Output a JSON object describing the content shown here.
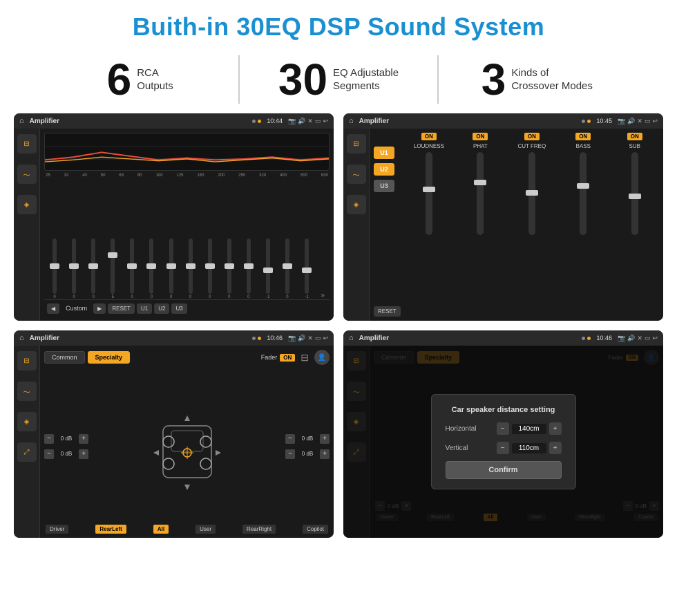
{
  "page": {
    "title": "Buith-in 30EQ DSP Sound System"
  },
  "stats": [
    {
      "number": "6",
      "label_line1": "RCA",
      "label_line2": "Outputs"
    },
    {
      "number": "30",
      "label_line1": "EQ Adjustable",
      "label_line2": "Segments"
    },
    {
      "number": "3",
      "label_line1": "Kinds of",
      "label_line2": "Crossover Modes"
    }
  ],
  "screens": [
    {
      "id": "screen1",
      "statusbar": {
        "title": "Amplifier",
        "time": "10:44"
      },
      "type": "eq",
      "freqs": [
        "25",
        "32",
        "40",
        "50",
        "63",
        "80",
        "100",
        "125",
        "160",
        "200",
        "250",
        "320",
        "400",
        "500",
        "630"
      ],
      "values": [
        "0",
        "0",
        "0",
        "5",
        "0",
        "0",
        "0",
        "0",
        "0",
        "0",
        "0",
        "-1",
        "0",
        "-1"
      ],
      "preset": "Custom",
      "buttons": [
        "RESET",
        "U1",
        "U2",
        "U3"
      ]
    },
    {
      "id": "screen2",
      "statusbar": {
        "title": "Amplifier",
        "time": "10:45"
      },
      "type": "amp",
      "presets": [
        "U1",
        "U2",
        "U3"
      ],
      "channels": [
        "LOUDNESS",
        "PHAT",
        "CUT FREQ",
        "BASS",
        "SUB"
      ],
      "reset_label": "RESET"
    },
    {
      "id": "screen3",
      "statusbar": {
        "title": "Amplifier",
        "time": "10:46"
      },
      "type": "fader",
      "tabs": [
        "Common",
        "Specialty"
      ],
      "fader_label": "Fader",
      "fader_on": "ON",
      "channels": [
        "Driver",
        "RearLeft",
        "All",
        "User",
        "RearRight",
        "Copilot"
      ],
      "db_values": [
        "0 dB",
        "0 dB",
        "0 dB",
        "0 dB"
      ]
    },
    {
      "id": "screen4",
      "statusbar": {
        "title": "Amplifier",
        "time": "10:46"
      },
      "type": "dialog",
      "dialog": {
        "title": "Car speaker distance setting",
        "fields": [
          {
            "label": "Horizontal",
            "value": "140cm"
          },
          {
            "label": "Vertical",
            "value": "110cm"
          }
        ],
        "confirm_label": "Confirm"
      },
      "tabs": [
        "Common",
        "Specialty"
      ],
      "channels": [
        "Driver",
        "RearLeft",
        "All",
        "User",
        "RearRight",
        "Copilot"
      ],
      "db_values": [
        "0 dB",
        "0 dB"
      ]
    }
  ]
}
